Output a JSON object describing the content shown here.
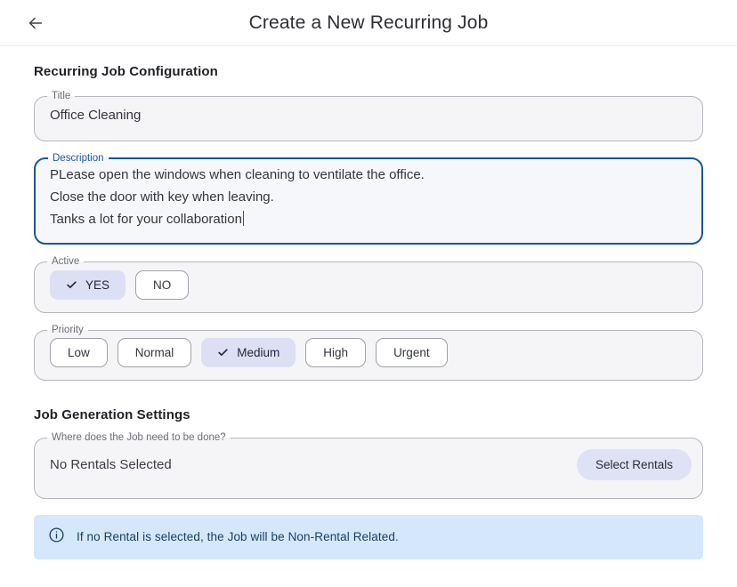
{
  "header": {
    "back_icon": "arrow-left-icon",
    "title": "Create a New Recurring Job"
  },
  "sections": {
    "config_title": "Recurring Job Configuration",
    "generation_title": "Job Generation Settings"
  },
  "fields": {
    "title": {
      "label": "Title",
      "value": "Office Cleaning"
    },
    "description": {
      "label": "Description",
      "value": "PLease open the windows when cleaning to ventilate the office.\nClose the door with key when leaving.\nTanks a lot for your collaboration",
      "focused": true
    },
    "active": {
      "label": "Active",
      "options": [
        {
          "label": "YES",
          "selected": true
        },
        {
          "label": "NO",
          "selected": false
        }
      ]
    },
    "priority": {
      "label": "Priority",
      "options": [
        {
          "label": "Low",
          "selected": false
        },
        {
          "label": "Normal",
          "selected": false
        },
        {
          "label": "Medium",
          "selected": true
        },
        {
          "label": "High",
          "selected": false
        },
        {
          "label": "Urgent",
          "selected": false
        }
      ]
    },
    "rentals": {
      "label": "Where does the Job need to be done?",
      "value": "No Rentals Selected",
      "button_label": "Select Rentals"
    }
  },
  "info_banner": {
    "icon": "info-circle-icon",
    "text": "If no Rental is selected, the Job will be Non-Rental Related."
  },
  "colors": {
    "accent_selected": "#dde0f4",
    "focus_border": "#19569f",
    "info_bg": "#d5e7fb",
    "info_text": "#19405f",
    "field_bg": "#f5f5f8"
  }
}
